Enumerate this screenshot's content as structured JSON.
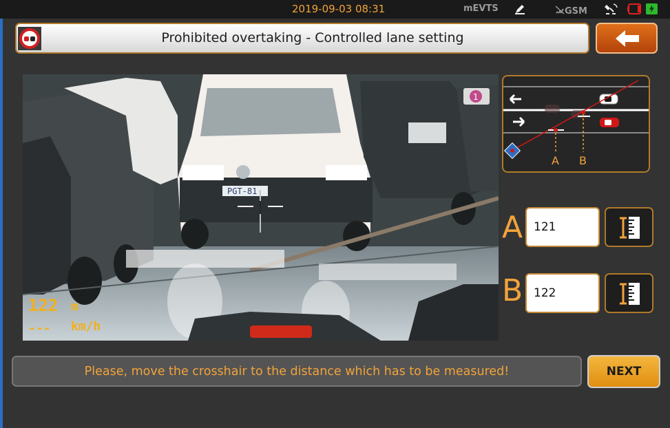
{
  "status_bar": {
    "datetime": "2019-09-03 08:31",
    "app_name": "mEVTS",
    "network": "GSM",
    "icons": [
      "pen-icon",
      "no-signal-icon",
      "satellite-icon",
      "battery-low-icon",
      "power-icon"
    ],
    "colors": {
      "datetime": "#f2a33a",
      "battery_low": "#e02020",
      "external_power": "#2eb82e"
    }
  },
  "title_bar": {
    "icon": "no-overtaking-sign-icon",
    "title": "Prohibited overtaking - Controlled lane setting"
  },
  "back_button": {
    "icon": "arrow-left-icon"
  },
  "camera": {
    "distance_value": "122",
    "distance_unit": "m",
    "speed_value": "---",
    "speed_unit": "km/h",
    "plate": "PGT-81",
    "indicator": "1"
  },
  "diagram": {
    "label_a": "A",
    "label_b": "B",
    "icons": [
      "arrow-left-icon",
      "arrow-right-icon",
      "car-white-icon",
      "car-red-icon",
      "camera-icon"
    ]
  },
  "points": {
    "a": {
      "label": "A",
      "value": "121"
    },
    "b": {
      "label": "B",
      "value": "122"
    }
  },
  "measure_icon": "ruler-icon",
  "hint": "Please, move the crosshair to the distance which has to be measured!",
  "next_label": "NEXT",
  "colors": {
    "accent": "#f2a33a",
    "border": "#b07a2a",
    "back_button": "#d05a12",
    "background": "#333333"
  }
}
